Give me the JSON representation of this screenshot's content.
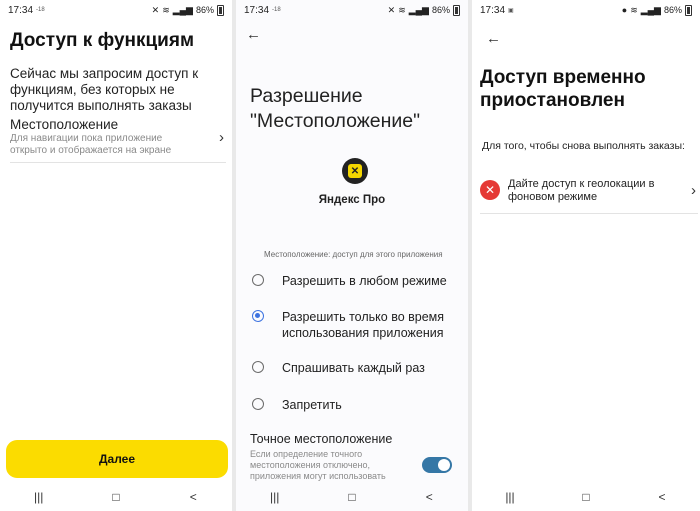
{
  "status_bar": {
    "time": "17:34",
    "small_indicator": "-18",
    "battery": "86%"
  },
  "screen1": {
    "title": "Доступ к функциям",
    "description": "Сейчас мы запросим доступ к функциям, без которых не получится выполнять заказы",
    "item": {
      "label": "Местоположение",
      "sublabel": "Для навигации пока приложение открыто и отображается на экране",
      "icon": "chevron-right-icon"
    },
    "next_button": "Далее",
    "accent_color": "#fbdc00"
  },
  "screen2": {
    "back_icon": "arrow-left-icon",
    "title_line1": "Разрешение",
    "title_line2": "\"Местоположение\"",
    "app_name": "Яндекс Про",
    "section_label": "Местоположение: доступ для этого приложения",
    "options": [
      {
        "label": "Разрешить в любом режиме",
        "selected": false
      },
      {
        "label": "Разрешить только во время использования приложения",
        "selected": true
      },
      {
        "label": "Спрашивать каждый раз",
        "selected": false
      },
      {
        "label": "Запретить",
        "selected": false
      }
    ],
    "precise": {
      "title": "Точное местоположение",
      "description": "Если определение точного местоположения отключено, приложения могут использовать",
      "enabled": true
    },
    "accent_color": "#3d73e0"
  },
  "screen3": {
    "back_icon": "arrow-left-icon",
    "title": "Доступ временно приостановлен",
    "description": "Для того, чтобы снова выполнять заказы:",
    "item": {
      "label": "Дайте доступ к геолокации в фоновом режиме",
      "icon": "error-x-icon",
      "chevron": "chevron-right-icon"
    },
    "error_color": "#e53935"
  },
  "nav_bar": {
    "recents": "|||",
    "home": "□",
    "back": "<"
  }
}
